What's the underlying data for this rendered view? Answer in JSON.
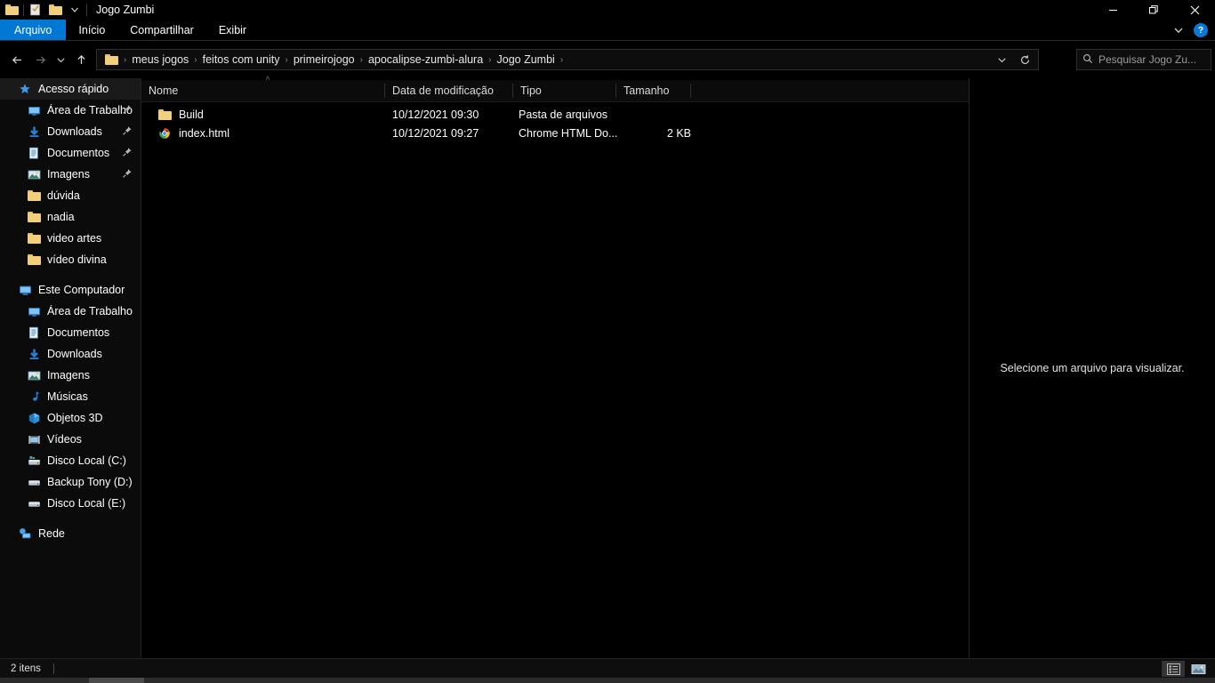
{
  "window": {
    "title": "Jogo Zumbi",
    "quick_access_toolbar": [
      {
        "name": "folder-properties-icon",
        "label": "Propriedades"
      },
      {
        "name": "new-folder-icon",
        "label": "Nova pasta"
      },
      {
        "name": "customize-dropdown-icon",
        "label": "Personalizar Barra de Ferramentas de Acesso Rápido"
      }
    ],
    "controls": {
      "minimize": "—",
      "maximize": "❐",
      "close": "✕"
    }
  },
  "ribbon": {
    "tabs": [
      {
        "label": "Arquivo",
        "active": true
      },
      {
        "label": "Início",
        "active": false
      },
      {
        "label": "Compartilhar",
        "active": false
      },
      {
        "label": "Exibir",
        "active": false
      }
    ],
    "collapse_label": "⌄",
    "help_label": "?"
  },
  "address_bar": {
    "back_label": "←",
    "forward_label": "→",
    "recent_label": "⌄",
    "up_label": "↑",
    "breadcrumbs": [
      "meus jogos",
      "feitos com unity",
      "primeirojogo",
      "apocalipse-zumbi-alura",
      "Jogo Zumbi"
    ],
    "separator": "›",
    "dropdown_label": "⌄",
    "refresh_label": "↻"
  },
  "search": {
    "placeholder": "Pesquisar Jogo Zu..."
  },
  "sidebar": {
    "sections": [
      {
        "header": {
          "label": "Acesso rápido",
          "icon": "star-icon",
          "active": true
        },
        "items": [
          {
            "label": "Área de Trabalho",
            "icon": "desktop-icon",
            "pinned": true
          },
          {
            "label": "Downloads",
            "icon": "download-icon",
            "pinned": true
          },
          {
            "label": "Documentos",
            "icon": "documents-icon",
            "pinned": true
          },
          {
            "label": "Imagens",
            "icon": "pictures-icon",
            "pinned": true
          },
          {
            "label": "dúvida",
            "icon": "folder-icon",
            "pinned": false
          },
          {
            "label": "nadia",
            "icon": "folder-icon",
            "pinned": false
          },
          {
            "label": "video artes",
            "icon": "folder-icon",
            "pinned": false
          },
          {
            "label": "vídeo divina",
            "icon": "folder-icon",
            "pinned": false
          }
        ]
      },
      {
        "header": {
          "label": "Este Computador",
          "icon": "this-pc-icon",
          "active": false
        },
        "items": [
          {
            "label": "Área de Trabalho",
            "icon": "desktop-icon",
            "pinned": false
          },
          {
            "label": "Documentos",
            "icon": "documents-icon",
            "pinned": false
          },
          {
            "label": "Downloads",
            "icon": "download-icon",
            "pinned": false
          },
          {
            "label": "Imagens",
            "icon": "pictures-icon",
            "pinned": false
          },
          {
            "label": "Músicas",
            "icon": "music-icon",
            "pinned": false
          },
          {
            "label": "Objetos 3D",
            "icon": "objects-3d-icon",
            "pinned": false
          },
          {
            "label": "Vídeos",
            "icon": "videos-icon",
            "pinned": false
          },
          {
            "label": "Disco Local (C:)",
            "icon": "system-drive-icon",
            "pinned": false
          },
          {
            "label": "Backup Tony (D:)",
            "icon": "drive-icon",
            "pinned": false
          },
          {
            "label": "Disco Local (E:)",
            "icon": "drive-icon",
            "pinned": false
          }
        ]
      },
      {
        "header": {
          "label": "Rede",
          "icon": "network-icon",
          "active": false
        },
        "items": []
      }
    ]
  },
  "file_list": {
    "columns": [
      {
        "label": "Nome",
        "sorted": "asc"
      },
      {
        "label": "Data de modificação",
        "sorted": ""
      },
      {
        "label": "Tipo",
        "sorted": ""
      },
      {
        "label": "Tamanho",
        "sorted": ""
      }
    ],
    "sort_indicator": "˄",
    "rows": [
      {
        "name": "Build",
        "icon": "folder-icon",
        "date": "10/12/2021 09:30",
        "type": "Pasta de arquivos",
        "size": ""
      },
      {
        "name": "index.html",
        "icon": "chrome-icon",
        "date": "10/12/2021 09:27",
        "type": "Chrome HTML Do...",
        "size": "2 KB"
      }
    ]
  },
  "preview_pane": {
    "message": "Selecione um arquivo para visualizar."
  },
  "status_bar": {
    "item_count": "2 itens",
    "views": [
      {
        "name": "details-view",
        "active": true
      },
      {
        "name": "large-icons-view",
        "active": false
      }
    ]
  },
  "colors": {
    "accent": "#0078d4",
    "folder": "#f2d07b",
    "background": "#000000",
    "sidebar_bg": "#0b0b0b",
    "close_hover": "#c42b1c"
  }
}
